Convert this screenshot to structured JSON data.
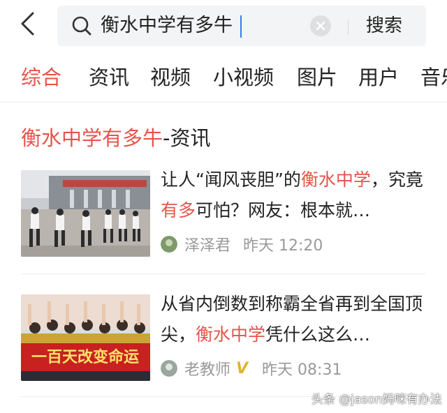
{
  "header": {
    "back_icon": "chevron-left-icon",
    "search_query": "衡水中学有多牛",
    "clear_icon": "clear-icon",
    "search_button": "搜索"
  },
  "tabs": [
    {
      "label": "综合",
      "active": true
    },
    {
      "label": "资讯",
      "active": false
    },
    {
      "label": "视频",
      "active": false
    },
    {
      "label": "小视频",
      "active": false
    },
    {
      "label": "图片",
      "active": false
    },
    {
      "label": "用户",
      "active": false
    },
    {
      "label": "音乐",
      "active": false
    }
  ],
  "section": {
    "highlight": "衡水中学有多牛",
    "suffix": "-资讯"
  },
  "articles": [
    {
      "headline_parts": [
        "让人“闻风丧胆”的",
        "衡水中学",
        "，究竟",
        "有多",
        "可怕？网友：根本就…"
      ],
      "author": "泽泽君",
      "verified": false,
      "time": "昨天 12:20"
    },
    {
      "headline_parts": [
        "从省内倒数到称霸全省再到全国顶尖，",
        "衡水中学",
        "凭什么这么…"
      ],
      "author": "老教师",
      "verified": true,
      "verified_mark": "V",
      "time": "昨天 08:31",
      "thumb_banner_text": "一百天改变命运"
    }
  ],
  "watermark": "头条 @jason妈咪有办法",
  "colors": {
    "accent": "#e8534a",
    "caret": "#2f7df6",
    "meta_text": "#999999",
    "verified": "#e3b22c"
  }
}
